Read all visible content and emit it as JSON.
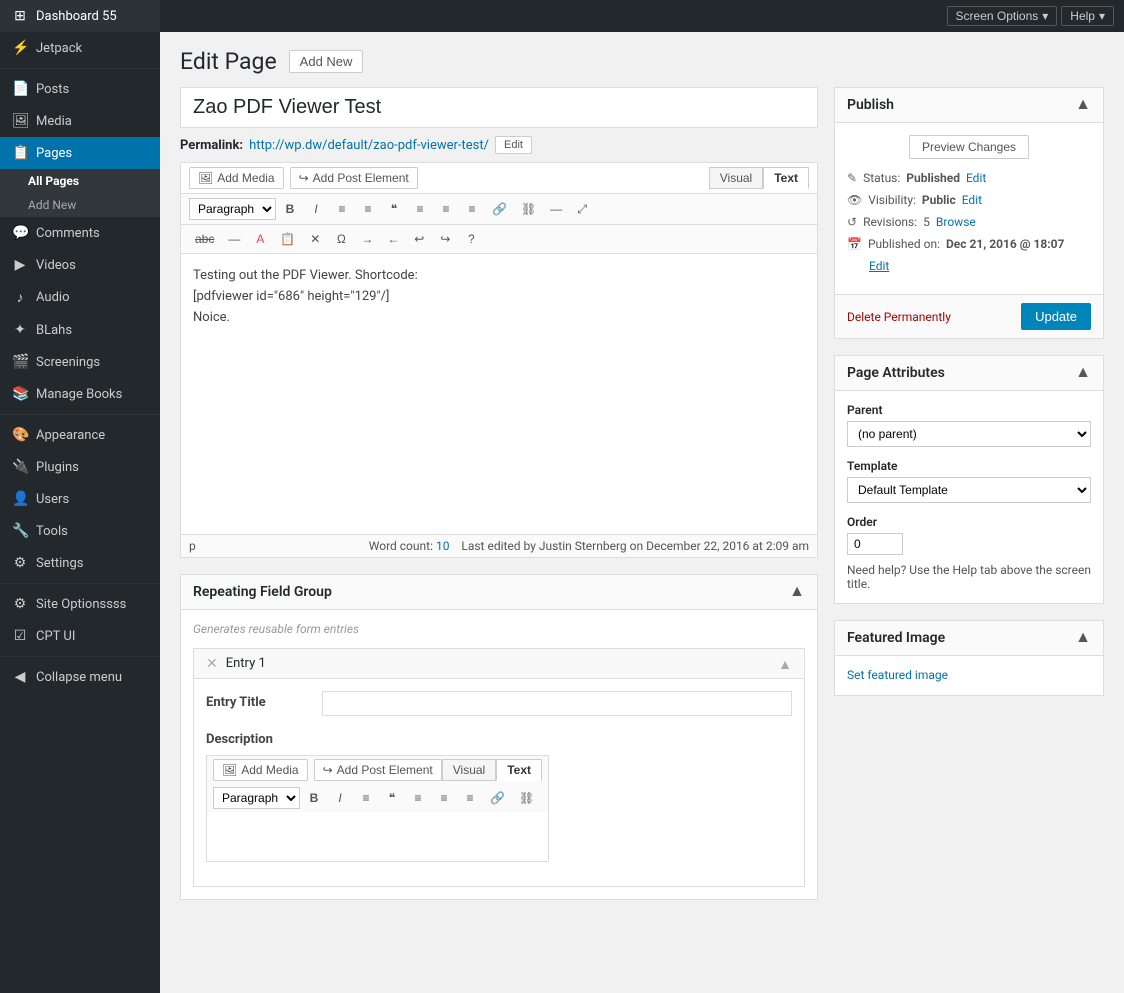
{
  "topbar": {
    "screen_options_label": "Screen Options",
    "help_label": "Help"
  },
  "sidebar": {
    "logo_label": "Dashboard 55",
    "items": [
      {
        "id": "dashboard",
        "label": "Dashboard 55",
        "icon": "⊞"
      },
      {
        "id": "jetpack",
        "label": "Jetpack",
        "icon": "⚡"
      },
      {
        "id": "posts",
        "label": "Posts",
        "icon": "📄"
      },
      {
        "id": "media",
        "label": "Media",
        "icon": "🖼"
      },
      {
        "id": "pages",
        "label": "Pages",
        "icon": "📋",
        "active": true
      },
      {
        "id": "comments",
        "label": "Comments",
        "icon": "💬"
      },
      {
        "id": "videos",
        "label": "Videos",
        "icon": "▶"
      },
      {
        "id": "audio",
        "label": "Audio",
        "icon": "♪"
      },
      {
        "id": "blahs",
        "label": "BLahs",
        "icon": "✦"
      },
      {
        "id": "screenings",
        "label": "Screenings",
        "icon": "🎬"
      },
      {
        "id": "manage-books",
        "label": "Manage Books",
        "icon": "📚"
      },
      {
        "id": "appearance",
        "label": "Appearance",
        "icon": "🎨"
      },
      {
        "id": "plugins",
        "label": "Plugins",
        "icon": "🔌"
      },
      {
        "id": "users",
        "label": "Users",
        "icon": "👤"
      },
      {
        "id": "tools",
        "label": "Tools",
        "icon": "🔧"
      },
      {
        "id": "settings",
        "label": "Settings",
        "icon": "⚙"
      },
      {
        "id": "site-optionssss",
        "label": "Site Optionssss",
        "icon": "⚙"
      },
      {
        "id": "cpt-ui",
        "label": "CPT UI",
        "icon": "☑"
      },
      {
        "id": "collapse-menu",
        "label": "Collapse menu",
        "icon": "◀"
      }
    ],
    "sub_menu": {
      "all_pages": "All Pages",
      "add_new": "Add New"
    }
  },
  "header": {
    "title": "Edit Page",
    "add_new_label": "Add New"
  },
  "editor": {
    "post_title": "Zao PDF Viewer Test",
    "permalink_label": "Permalink:",
    "permalink_url": "http://wp.dw/default/zao-pdf-viewer-test/",
    "permalink_edit": "Edit",
    "add_media_label": "Add Media",
    "add_post_element_label": "Add Post Element",
    "tab_visual": "Visual",
    "tab_text": "Text",
    "toolbar": {
      "format_select": "Paragraph",
      "bold": "B",
      "italic": "I",
      "ul": "≡",
      "ol": "≡",
      "blockquote": "❝",
      "align_left": "≡",
      "align_center": "≡",
      "align_right": "≡",
      "link": "🔗",
      "unlink": "⛓",
      "more": "—",
      "fullscreen": "⤢"
    },
    "content_lines": [
      "Testing out the PDF Viewer. Shortcode:",
      "",
      "[pdfviewer id=\"686\" height=\"129\"/]",
      "",
      "Noice."
    ],
    "path": "p",
    "word_count_label": "Word count:",
    "word_count": "10",
    "last_edited": "Last edited by Justin Sternberg on December 22, 2016 at 2:09 am"
  },
  "repeating_field_group": {
    "title": "Repeating Field Group",
    "description": "Generates reusable form entries",
    "entry": {
      "title": "Entry 1",
      "field_title_label": "Entry Title",
      "field_title_placeholder": "",
      "field_desc_label": "Description",
      "add_media_label": "Add Media",
      "add_post_element_label": "Add Post Element",
      "tab_visual": "Visual",
      "tab_text": "Text",
      "toolbar_format": "Paragraph",
      "toolbar_bold": "B",
      "toolbar_italic": "I",
      "toolbar_ul": "≡",
      "toolbar_blockquote": "❝",
      "toolbar_align_left": "≡",
      "toolbar_align_center": "≡",
      "toolbar_align_right": "≡",
      "toolbar_link": "🔗",
      "toolbar_unlink": "⛓"
    }
  },
  "publish": {
    "title": "Publish",
    "preview_changes": "Preview Changes",
    "status_label": "Status:",
    "status_value": "Published",
    "status_edit": "Edit",
    "visibility_label": "Visibility:",
    "visibility_value": "Public",
    "visibility_edit": "Edit",
    "revisions_label": "Revisions:",
    "revisions_count": "5",
    "revisions_browse": "Browse",
    "published_on_label": "Published on:",
    "published_on_value": "Dec 21, 2016 @ 18:07",
    "published_on_edit": "Edit",
    "delete_label": "Delete Permanently",
    "update_label": "Update"
  },
  "page_attributes": {
    "title": "Page Attributes",
    "parent_label": "Parent",
    "parent_value": "(no parent)",
    "template_label": "Template",
    "template_value": "Default Template",
    "order_label": "Order",
    "order_value": "0",
    "help_text": "Need help? Use the Help tab above the screen title."
  },
  "featured_image": {
    "title": "Featured Image",
    "set_link": "Set featured image"
  }
}
